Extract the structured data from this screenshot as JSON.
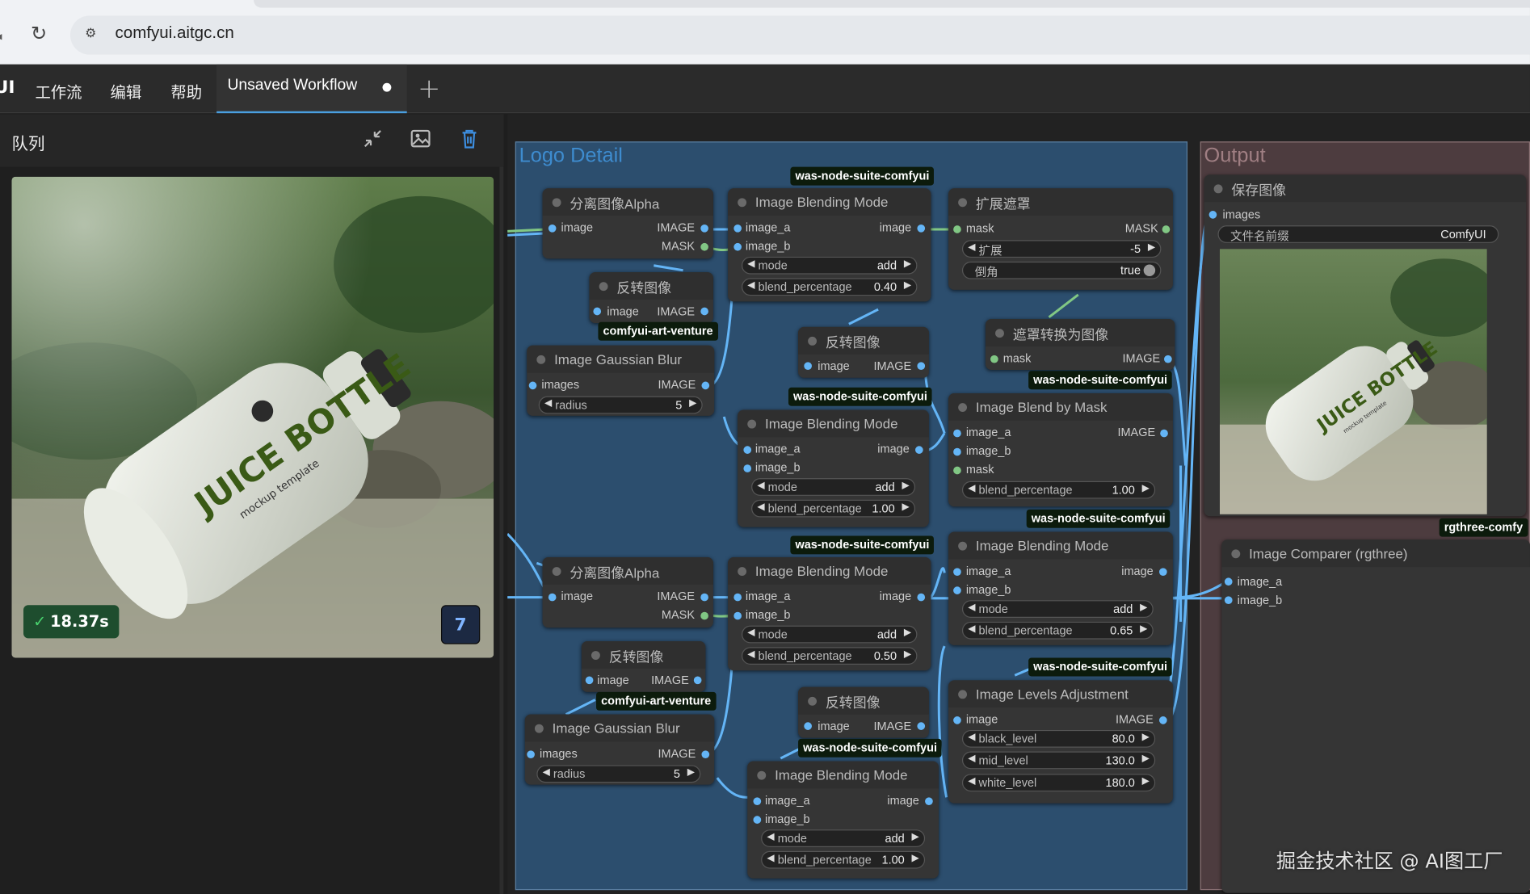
{
  "browser": {
    "url": "comfyui.aitgc.cn"
  },
  "topbar": {
    "logo": "UI",
    "menu": [
      "工作流",
      "编辑",
      "帮助"
    ],
    "tab_label": "Unsaved Workflow"
  },
  "queue": {
    "title": "队列",
    "time": "18.37s",
    "count": "7"
  },
  "groups": {
    "logo": "Logo Detail",
    "output": "Output"
  },
  "tags": {
    "was": "was-node-suite-comfyui",
    "art": "comfyui-art-venture",
    "rgthree": "rgthree-comfy"
  },
  "nodes": {
    "split_alpha": "分离图像Alpha",
    "invert": "反转图像",
    "gauss": "Image Gaussian Blur",
    "blend_mode": "Image Blending Mode",
    "expand_mask": "扩展遮罩",
    "mask_to_image": "遮罩转换为图像",
    "blend_by_mask": "Image Blend by Mask",
    "levels": "Image Levels Adjustment",
    "save": "保存图像",
    "comparer": "Image Comparer (rgthree)"
  },
  "slots": {
    "image": "image",
    "images": "images",
    "IMAGE": "IMAGE",
    "MASK": "MASK",
    "mask": "mask",
    "image_a": "image_a",
    "image_b": "image_b"
  },
  "widgets": {
    "mode": "mode",
    "add": "add",
    "blend_percentage": "blend_percentage",
    "radius": "radius",
    "radius_val": "5",
    "expand": "扩展",
    "expand_val": "-5",
    "taper": "倒角",
    "taper_val": "true",
    "bp_040": "0.40",
    "bp_100": "1.00",
    "bp_050": "0.50",
    "bp_065": "0.65",
    "black_level": "black_level",
    "black_val": "80.0",
    "mid_level": "mid_level",
    "mid_val": "130.0",
    "white_level": "white_level",
    "white_val": "180.0",
    "prefix": "文件名前缀",
    "prefix_val": "ComfyUI"
  },
  "bottle_text": {
    "juice": "JUICE BOTTLE",
    "sub": "mockup template"
  },
  "watermark": "掘金技术社区 @ AI图工厂",
  "colors": {
    "image_pin": "#64b5f6",
    "mask_pin": "#81c784",
    "logo_group": "#2c4e6e",
    "output_group": "#4d3c3f",
    "accent": "#4a9fe0"
  }
}
